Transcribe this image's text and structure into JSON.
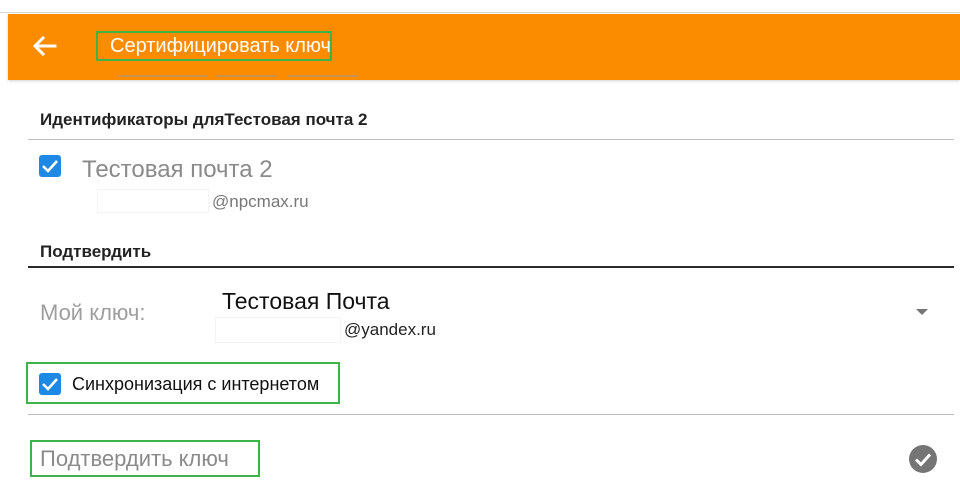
{
  "app_bar": {
    "title": "Сертифицировать ключ",
    "back_icon": "arrow-back-icon",
    "background": "#fb8c00",
    "annotation_color": "#3fb24a"
  },
  "identities_section": {
    "header": "Идентификаторы дляТестовая почта 2",
    "items": [
      {
        "checked": true,
        "name": "Тестовая почта 2",
        "email_domain": "@npcmax.ru"
      }
    ]
  },
  "confirm_section": {
    "header": "Подтвердить",
    "my_key_label": "Мой ключ:",
    "selected_key": {
      "name": "Тестовая Почта",
      "email_domain": "@yandex.ru"
    },
    "dropdown_icon": "dropdown-arrow-icon"
  },
  "sync": {
    "checked": true,
    "label": "Синхронизация с интернетом"
  },
  "action": {
    "label": "Подтвердить ключ",
    "icon": "check-circle-icon"
  }
}
